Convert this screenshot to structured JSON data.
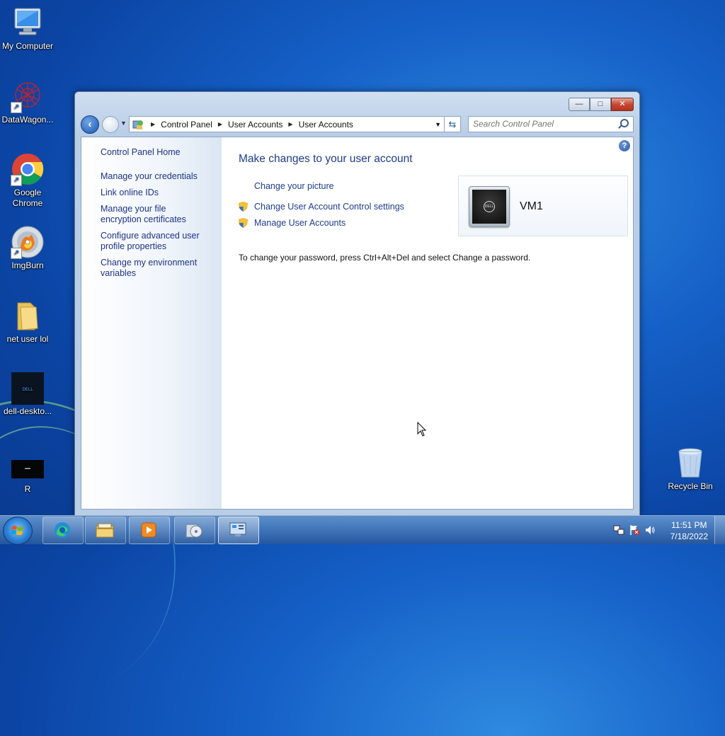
{
  "desktop": {
    "icons": [
      {
        "label": "My Computer"
      },
      {
        "label": "DataWagon..."
      },
      {
        "label": "Google Chrome"
      },
      {
        "label": "ImgBurn"
      },
      {
        "label": "net user lol"
      },
      {
        "label": "dell-deskto..."
      },
      {
        "label": "R"
      },
      {
        "label": "Recycle Bin"
      }
    ]
  },
  "window": {
    "buttons": {
      "minimize": "—",
      "maximize": "□",
      "close": "✕"
    },
    "breadcrumb": [
      "Control Panel",
      "User Accounts",
      "User Accounts"
    ],
    "search_placeholder": "Search Control Panel",
    "sidebar": {
      "home": "Control Panel Home",
      "tasks": [
        "Manage your credentials",
        "Link online IDs",
        "Manage your file encryption certificates",
        "Configure advanced user profile properties",
        "Change my environment variables"
      ]
    },
    "main": {
      "title": "Make changes to your user account",
      "links": {
        "change_picture": "Change your picture",
        "uac_settings": "Change User Account Control settings",
        "manage_accounts": "Manage User Accounts"
      },
      "password_text": "To change your password, press Ctrl+Alt+Del and select Change a password.",
      "user": {
        "name": "VM1",
        "avatar_logo": "DELL"
      },
      "help": "?"
    }
  },
  "taskbar": {
    "items": [
      "file-explorer",
      "microsoft-edge",
      "media-player",
      "disc-burner",
      "control-panel"
    ],
    "active": "control-panel",
    "clock": {
      "time": "11:51 PM",
      "date": "7/18/2022"
    }
  },
  "colors": {
    "link": "#1e3c8a",
    "desktop": "#1560c7",
    "close": "#c44a34"
  }
}
